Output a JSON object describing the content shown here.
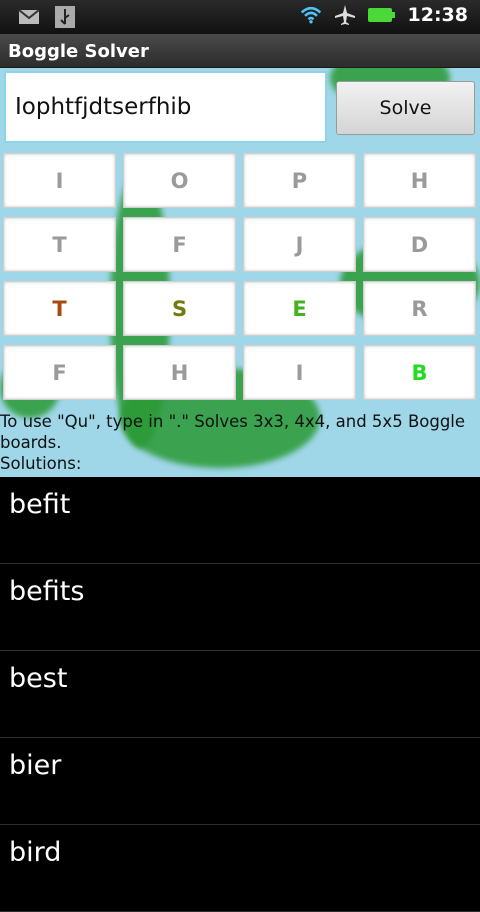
{
  "status_bar": {
    "time": "12:38",
    "left_icons": [
      "gmail-icon",
      "usb-icon"
    ],
    "right_icons": [
      "wifi-icon",
      "airplane-icon",
      "battery-icon"
    ]
  },
  "app": {
    "title": "Boggle Solver"
  },
  "input": {
    "value": "Iophtfjdtserfhib"
  },
  "solve_button": {
    "label": "Solve"
  },
  "board": {
    "rows": [
      [
        {
          "letter": "I",
          "color": "#9a9a9a"
        },
        {
          "letter": "O",
          "color": "#9a9a9a"
        },
        {
          "letter": "P",
          "color": "#9a9a9a"
        },
        {
          "letter": "H",
          "color": "#9a9a9a"
        }
      ],
      [
        {
          "letter": "T",
          "color": "#9a9a9a"
        },
        {
          "letter": "F",
          "color": "#9a9a9a"
        },
        {
          "letter": "J",
          "color": "#9a9a9a"
        },
        {
          "letter": "D",
          "color": "#9a9a9a"
        }
      ],
      [
        {
          "letter": "T",
          "color": "#a84a12"
        },
        {
          "letter": "S",
          "color": "#707a10"
        },
        {
          "letter": "E",
          "color": "#46b020"
        },
        {
          "letter": "R",
          "color": "#9a9a9a"
        }
      ],
      [
        {
          "letter": "F",
          "color": "#9a9a9a"
        },
        {
          "letter": "H",
          "color": "#9a9a9a"
        },
        {
          "letter": "I",
          "color": "#9a9a9a"
        },
        {
          "letter": "B",
          "color": "#22dd22"
        }
      ]
    ]
  },
  "info": {
    "instructions": "To use \"Qu\", type in \".\" Solves 3x3, 4x4, and 5x5 Boggle boards.",
    "solutions_label": "Solutions:"
  },
  "solutions": [
    "befit",
    "befits",
    "best",
    "bier",
    "bird"
  ]
}
